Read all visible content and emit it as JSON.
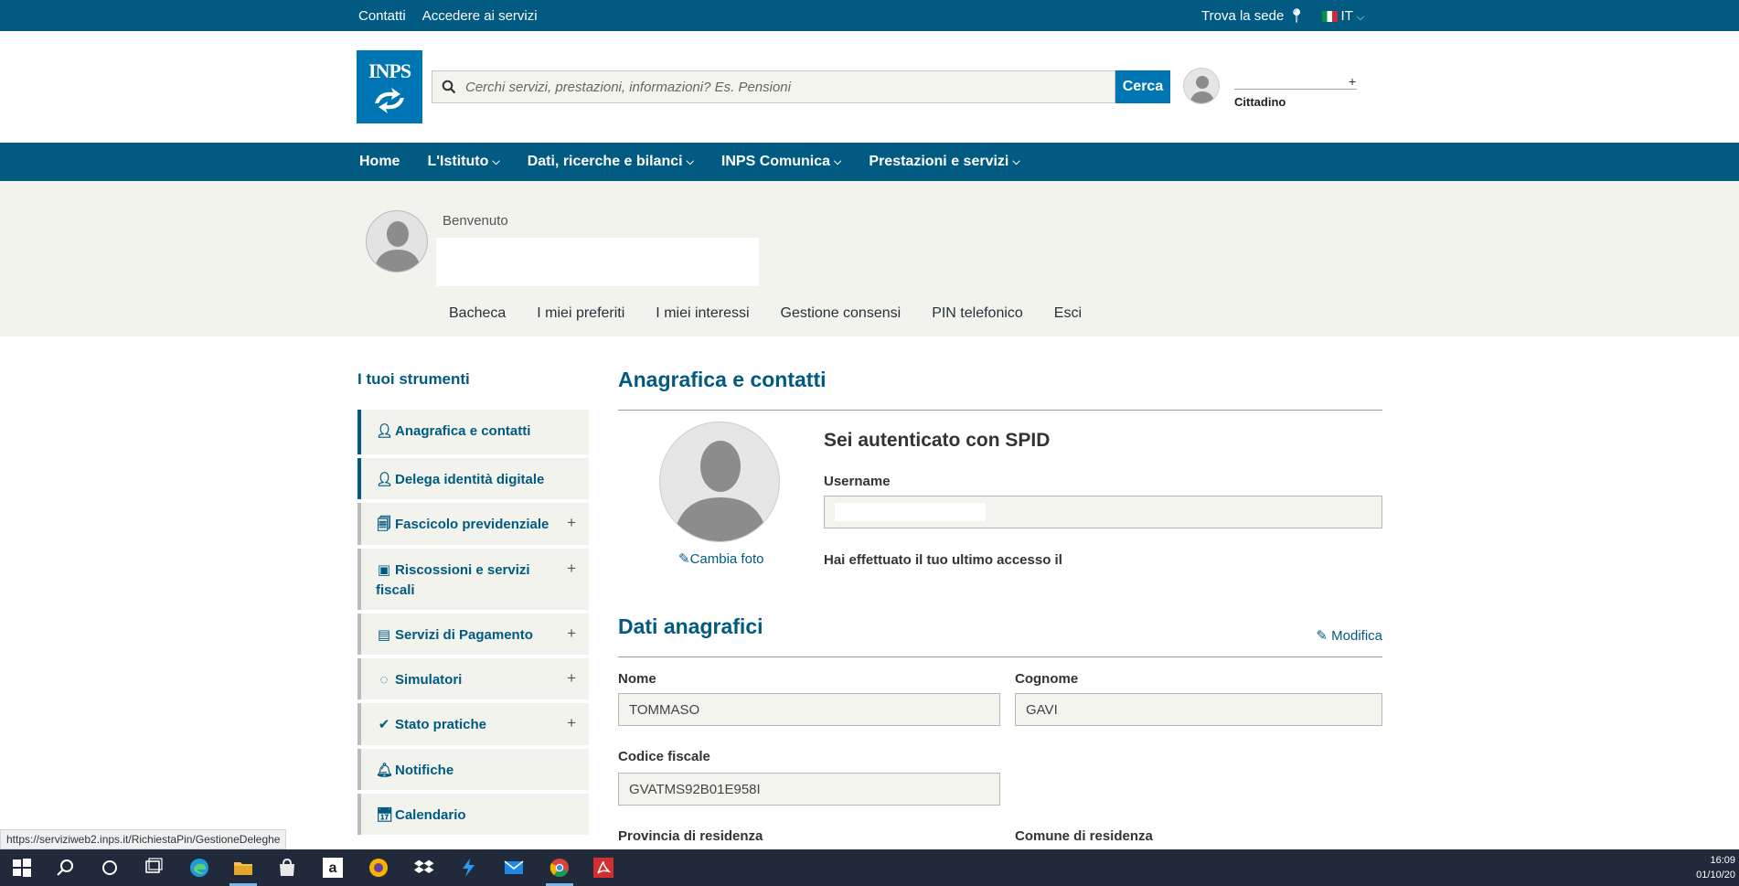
{
  "topbar": {
    "contatti": "Contatti",
    "accedere": "Accedere ai servizi",
    "trova_sede": "Trova la sede",
    "lang": "IT"
  },
  "header": {
    "logo_text": "INPS",
    "search_placeholder": "Cerchi servizi, prestazioni, informazioni? Es. Pensioni",
    "search_button": "Cerca",
    "user_plus": "+",
    "user_role": "Cittadino"
  },
  "nav": {
    "items": [
      {
        "label": "Home",
        "has_dropdown": false
      },
      {
        "label": "L'Istituto",
        "has_dropdown": true
      },
      {
        "label": "Dati, ricerche e bilanci",
        "has_dropdown": true
      },
      {
        "label": "INPS Comunica",
        "has_dropdown": true
      },
      {
        "label": "Prestazioni e servizi",
        "has_dropdown": true
      }
    ]
  },
  "welcome": {
    "benvenuto": "Benvenuto",
    "tabs": [
      "Bacheca",
      "I miei preferiti",
      "I miei interessi",
      "Gestione consensi",
      "PIN telefonico",
      "Esci"
    ]
  },
  "sidebar": {
    "title": "I tuoi strumenti",
    "items": [
      {
        "label": "Anagrafica e contatti",
        "icon": "user-icon",
        "expandable": false
      },
      {
        "label": "Delega identità digitale",
        "icon": "user-plus-icon",
        "expandable": false
      },
      {
        "label": "Fascicolo previdenziale",
        "icon": "files-icon",
        "expandable": true
      },
      {
        "label": "Riscossioni e servizi fiscali",
        "icon": "archive-icon",
        "expandable": true
      },
      {
        "label": "Servizi di Pagamento",
        "icon": "money-icon",
        "expandable": true
      },
      {
        "label": "Simulatori",
        "icon": "spinner-icon",
        "expandable": true
      },
      {
        "label": "Stato pratiche",
        "icon": "check-icon",
        "expandable": true
      },
      {
        "label": "Notifiche",
        "icon": "bell-icon",
        "expandable": false
      },
      {
        "label": "Calendario",
        "icon": "calendar-icon",
        "expandable": false
      }
    ],
    "plus": "+"
  },
  "main": {
    "section_title": "Anagrafica e contatti",
    "cambia_foto": "Cambia foto",
    "spid_title": "Sei autenticato con SPID",
    "username_label": "Username",
    "username_value": "",
    "ultimo_accesso": "Hai effettuato il tuo ultimo accesso il",
    "dati_title": "Dati anagrafici",
    "modifica": "Modifica",
    "nome_label": "Nome",
    "nome_value": "TOMMASO",
    "cognome_label": "Cognome",
    "cognome_value": "GAVI",
    "cf_label": "Codice fiscale",
    "cf_value": "GVATMS92B01E958I",
    "provincia_label": "Provincia di residenza",
    "comune_label": "Comune di residenza"
  },
  "status_url": "https://serviziweb2.inps.it/RichiestaPin/GestioneDeleghe",
  "taskbar": {
    "time": "16:09",
    "date": "01/10/20"
  },
  "colors": {
    "brand_dark": "#005a82",
    "brand_light": "#0075b3",
    "band": "#f3f3ee"
  }
}
